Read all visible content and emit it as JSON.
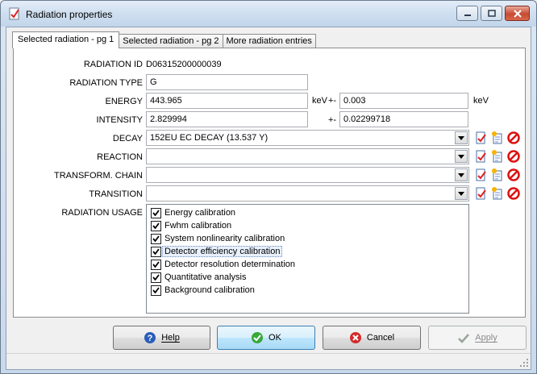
{
  "window": {
    "title": "Radiation properties"
  },
  "tabs": [
    {
      "label": "Selected radiation - pg 1",
      "active": true
    },
    {
      "label": "Selected radiation - pg 2",
      "active": false
    },
    {
      "label": "More radiation entries",
      "active": false
    }
  ],
  "form": {
    "radiation_id_label": "RADIATION ID",
    "radiation_id_value": "D06315200000039",
    "radiation_type_label": "RADIATION TYPE",
    "radiation_type_value": "G",
    "energy_label": "ENERGY",
    "energy_value": "443.965",
    "energy_unit": "keV",
    "energy_pm": "+-",
    "energy_uncertainty": "0.003",
    "energy_uncertainty_unit": "keV",
    "intensity_label": "INTENSITY",
    "intensity_value": "2.829994",
    "intensity_pm": "+-",
    "intensity_uncertainty": "0.02299718",
    "decay_label": "DECAY",
    "decay_value": "152EU EC DECAY (13.537 Y)",
    "reaction_label": "REACTION",
    "reaction_value": "",
    "transform_chain_label": "TRANSFORM. CHAIN",
    "transform_chain_value": "",
    "transition_label": "TRANSITION",
    "transition_value": "",
    "radiation_usage_label": "RADIATION USAGE"
  },
  "usage_items": [
    {
      "label": "Energy calibration",
      "checked": true
    },
    {
      "label": "Fwhm calibration",
      "checked": true
    },
    {
      "label": "System nonlinearity calibration",
      "checked": true
    },
    {
      "label": "Detector efficiency calibration",
      "checked": true,
      "focused": true
    },
    {
      "label": "Detector resolution determination",
      "checked": true
    },
    {
      "label": "Quantitative analysis",
      "checked": true
    },
    {
      "label": "Background calibration",
      "checked": true
    }
  ],
  "buttons": {
    "help": "Help",
    "ok": "OK",
    "cancel": "Cancel",
    "apply": "Apply"
  },
  "icons": {
    "row_actions": [
      "edit-document-icon",
      "new-document-icon",
      "delete-icon"
    ]
  }
}
